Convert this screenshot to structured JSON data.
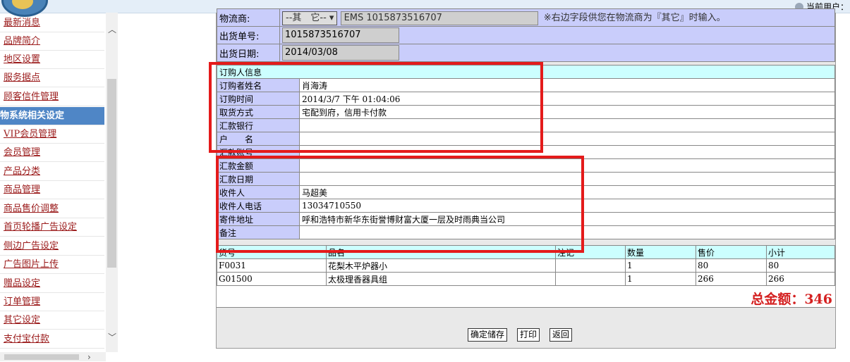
{
  "header": {
    "current_user_label": "当前用户："
  },
  "sidebar": {
    "items": [
      {
        "label": "最新消息"
      },
      {
        "label": "品牌简介"
      },
      {
        "label": "地区设置"
      },
      {
        "label": "服务据点"
      },
      {
        "label": "顾客信件管理"
      },
      {
        "label": "物系统相关设定",
        "header": true
      },
      {
        "label": "VIP会员管理"
      },
      {
        "label": "会员管理"
      },
      {
        "label": "产品分类"
      },
      {
        "label": "商品管理"
      },
      {
        "label": "商品售价调整"
      },
      {
        "label": "首页轮播广告设定"
      },
      {
        "label": "侧边广告设定"
      },
      {
        "label": "广告图片上传"
      },
      {
        "label": "赠品设定"
      },
      {
        "label": "订单管理"
      },
      {
        "label": "其它设定"
      },
      {
        "label": "支付宝付款"
      }
    ]
  },
  "shipping": {
    "carrier_label": "物流商:",
    "carrier_selected": "--其　它--",
    "carrier_value": "EMS 1015873516707",
    "carrier_note": "※右边字段供您在物流商为『其它』时输入。",
    "ship_no_label": "出货单号:",
    "ship_no_value": "1015873516707",
    "ship_date_label": "出货日期:",
    "ship_date_value": "2014/03/08"
  },
  "order_info": {
    "section_title": "订购人信息",
    "rows": [
      {
        "label": "订购者姓名",
        "value": "肖海涛"
      },
      {
        "label": "订购时间",
        "value": "2014/3/7 下午 01:04:06"
      },
      {
        "label": "取货方式",
        "value": "宅配到府，信用卡付款"
      },
      {
        "label": "汇款银行",
        "value": ""
      },
      {
        "label": "户　　名",
        "value": ""
      },
      {
        "label": "汇款账号",
        "value": ""
      },
      {
        "label": "汇款金额",
        "value": ""
      },
      {
        "label": "汇款日期",
        "value": ""
      },
      {
        "label": "收件人",
        "value": "马超美"
      },
      {
        "label": "收件人电话",
        "value": "13034710550"
      },
      {
        "label": "寄件地址",
        "value": "呼和浩特市新华东街誉博财富大厦一层及时雨典当公司"
      },
      {
        "label": "备注",
        "value": ""
      }
    ]
  },
  "items_table": {
    "headers": [
      "货号",
      "品名",
      "注记",
      "数量",
      "售价",
      "小计"
    ],
    "rows": [
      [
        "F0031",
        "花梨木平炉器小",
        "",
        "1",
        "80",
        "80"
      ],
      [
        "G01500",
        "太极理香器具组",
        "",
        "1",
        "266",
        "266"
      ]
    ]
  },
  "total": {
    "label": "总金额：346"
  },
  "buttons": {
    "save": "确定储存",
    "print": "打印",
    "back": "返回"
  },
  "colors": {
    "highlight_box": "#e41b1b",
    "label_bg": "#c9cdfb",
    "section_bg": "#ccffff",
    "total_text": "#d42020"
  }
}
